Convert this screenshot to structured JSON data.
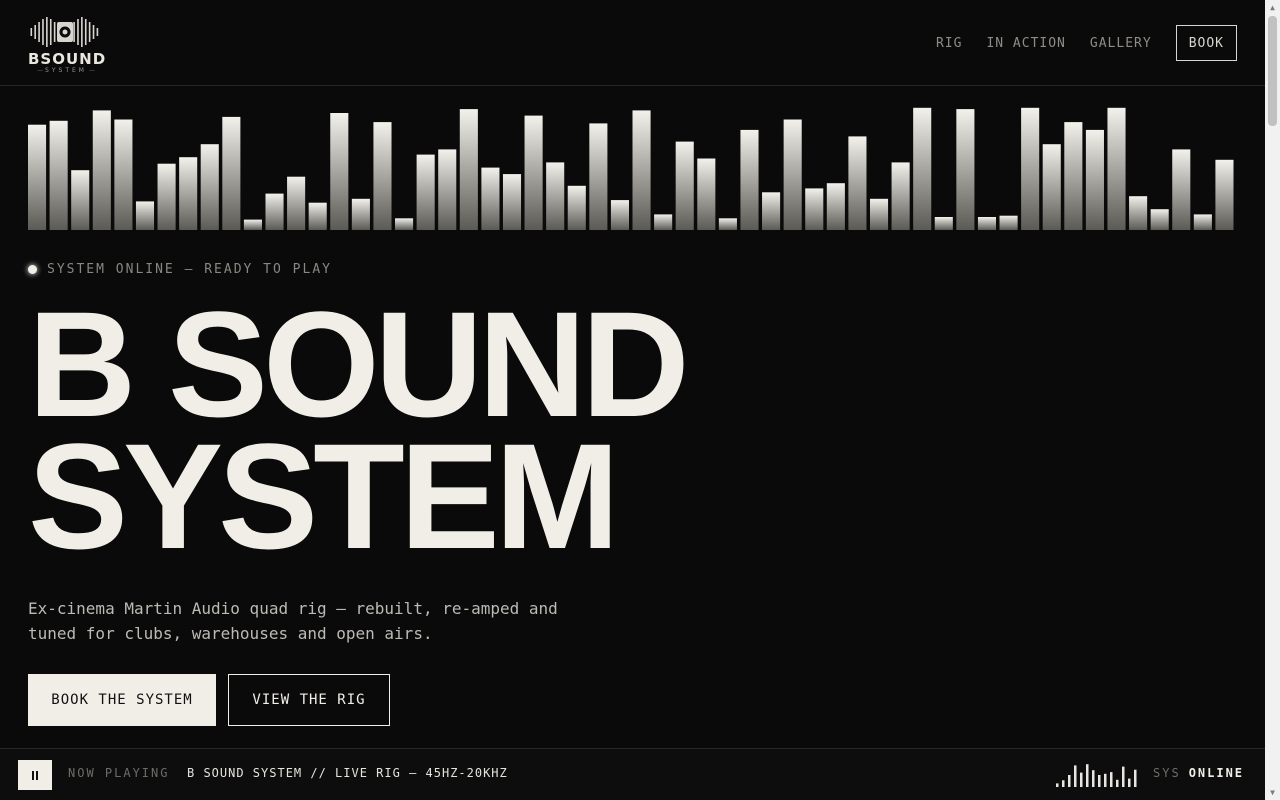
{
  "logo": {
    "text": "BSOUND",
    "subtext": "SYSTEM"
  },
  "nav": {
    "links": [
      "RIG",
      "IN ACTION",
      "GALLERY"
    ],
    "book": "BOOK"
  },
  "equalizer": {
    "levels": [
      0.81,
      0.84,
      0.46,
      0.92,
      0.85,
      0.22,
      0.51,
      0.56,
      0.66,
      0.87,
      0.08,
      0.28,
      0.41,
      0.21,
      0.9,
      0.24,
      0.83,
      0.09,
      0.58,
      0.62,
      0.93,
      0.48,
      0.43,
      0.88,
      0.52,
      0.34,
      0.82,
      0.23,
      0.92,
      0.12,
      0.68,
      0.55,
      0.09,
      0.77,
      0.29,
      0.85,
      0.32,
      0.36,
      0.72,
      0.24,
      0.52,
      0.94,
      0.1,
      0.93,
      0.1,
      0.11,
      0.94,
      0.66,
      0.83,
      0.77,
      0.94,
      0.26,
      0.16,
      0.62,
      0.12,
      0.54
    ]
  },
  "status": "SYSTEM ONLINE — READY TO PLAY",
  "hero": {
    "title_lines": [
      "B SOUND",
      "SYSTEM"
    ],
    "subtitle": "Ex-cinema Martin Audio quad rig — rebuilt, re-amped and tuned for clubs, warehouses and open airs.",
    "primary_cta": "BOOK THE SYSTEM",
    "secondary_cta": "VIEW THE RIG"
  },
  "player": {
    "now_playing_label": "NOW PLAYING",
    "track": "B SOUND SYSTEM // LIVE RIG — 45HZ-20KHZ",
    "mini_levels": [
      0.15,
      0.28,
      0.5,
      0.9,
      0.6,
      0.95,
      0.7,
      0.5,
      0.55,
      0.62,
      0.3,
      0.85,
      0.35,
      0.72
    ],
    "sys_label": "SYS",
    "sys_state": "ONLINE"
  },
  "colors": {
    "background": "#0a0a0a",
    "foreground": "#f1eee8",
    "muted": "#8a8781"
  }
}
